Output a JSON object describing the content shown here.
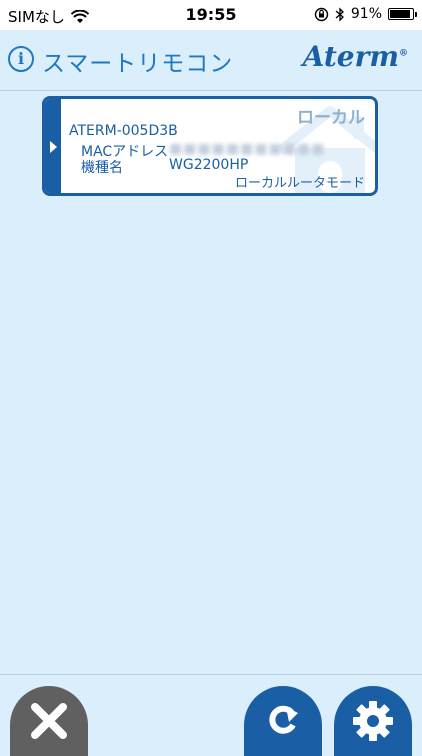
{
  "status_bar": {
    "carrier": "SIMなし",
    "time": "19:55",
    "battery_percent": "91%",
    "battery_level": 0.91,
    "icons": [
      "wifi-icon",
      "orientation-lock-icon",
      "bluetooth-icon",
      "battery-icon"
    ]
  },
  "header": {
    "title": "スマートリモコン",
    "info_icon": "i",
    "brand": "Aterm",
    "brand_mark": "®"
  },
  "device": {
    "name": "ATERM-005D3B",
    "mode_badge": "ローカル",
    "mac_label": "MACアドレス",
    "mac_value": "■■■■■■■■■■■",
    "model_label": "機種名",
    "model_value": "WG2200HP",
    "router_mode": "ローカルルータモード"
  },
  "toolbar": {
    "close_icon": "close-icon",
    "refresh_icon": "refresh-icon",
    "settings_icon": "gear-icon"
  },
  "colors": {
    "background": "#dbeefb",
    "accent": "#1f78c6",
    "dark_accent": "#1a5fa6",
    "close_button": "#606060"
  }
}
